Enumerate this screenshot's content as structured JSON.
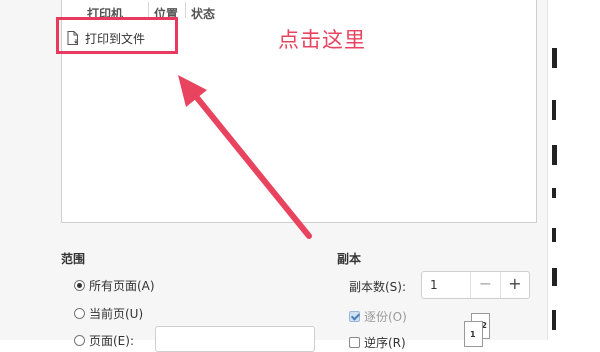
{
  "printer_list": {
    "columns": [
      "打印机",
      "位置",
      "状态"
    ],
    "rows": [
      {
        "name": "打印到文件",
        "icon": "file-print-icon"
      }
    ]
  },
  "annotation": {
    "text": "点击这里",
    "color": "#e8445f"
  },
  "range": {
    "title": "范围",
    "options": [
      {
        "label": "所有页面(A)",
        "selected": true
      },
      {
        "label": "当前页(U)",
        "selected": false
      },
      {
        "label": "页面(E):",
        "selected": false
      }
    ]
  },
  "copies": {
    "title": "副本",
    "count_label": "副本数(S):",
    "count_value": "1",
    "minus": "−",
    "plus": "+",
    "collate_label": "逐份(O)",
    "collate_checked": true,
    "reverse_label": "逆序(R)",
    "reverse_checked": false,
    "preview_pages": [
      "1",
      "2"
    ]
  }
}
